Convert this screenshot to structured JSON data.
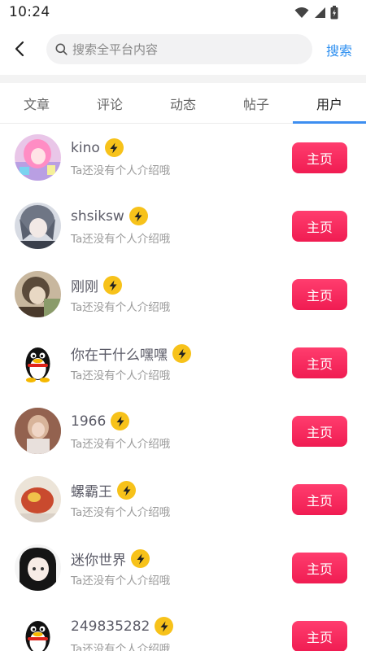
{
  "status_bar": {
    "time": "10:24",
    "icons": [
      "wifi-icon",
      "signal-icon",
      "battery-icon"
    ]
  },
  "header": {
    "back_icon": "chevron-left-icon",
    "search_icon": "search-icon",
    "search_placeholder": "搜索全平台内容",
    "search_value": "",
    "search_button": "搜索"
  },
  "tabs": [
    {
      "label": "文章",
      "active": false
    },
    {
      "label": "评论",
      "active": false
    },
    {
      "label": "动态",
      "active": false
    },
    {
      "label": "帖子",
      "active": false
    },
    {
      "label": "用户",
      "active": true
    }
  ],
  "users": [
    {
      "name": "kino",
      "bio": "Ta还没有个人介绍哦",
      "action": "主页",
      "badge_icon": "lightning-icon"
    },
    {
      "name": "shsiksw",
      "bio": "Ta还没有个人介绍哦",
      "action": "主页",
      "badge_icon": "lightning-icon"
    },
    {
      "name": "刚刚",
      "bio": "Ta还没有个人介绍哦",
      "action": "主页",
      "badge_icon": "lightning-icon"
    },
    {
      "name": "你在干什么嘿嘿",
      "bio": "Ta还没有个人介绍哦",
      "action": "主页",
      "badge_icon": "lightning-icon"
    },
    {
      "name": "1966",
      "bio": "Ta还没有个人介绍哦",
      "action": "主页",
      "badge_icon": "lightning-icon"
    },
    {
      "name": "螺霸王",
      "bio": "Ta还没有个人介绍哦",
      "action": "主页",
      "badge_icon": "lightning-icon"
    },
    {
      "name": "迷你世界",
      "bio": "Ta还没有个人介绍哦",
      "action": "主页",
      "badge_icon": "lightning-icon"
    },
    {
      "name": "249835282",
      "bio": "Ta还没有个人介绍哦",
      "action": "主页",
      "badge_icon": "lightning-icon"
    }
  ],
  "colors": {
    "accent_blue": "#2b8ef0",
    "button_pink": "#f01c52",
    "badge_yellow": "#f7c21a"
  }
}
